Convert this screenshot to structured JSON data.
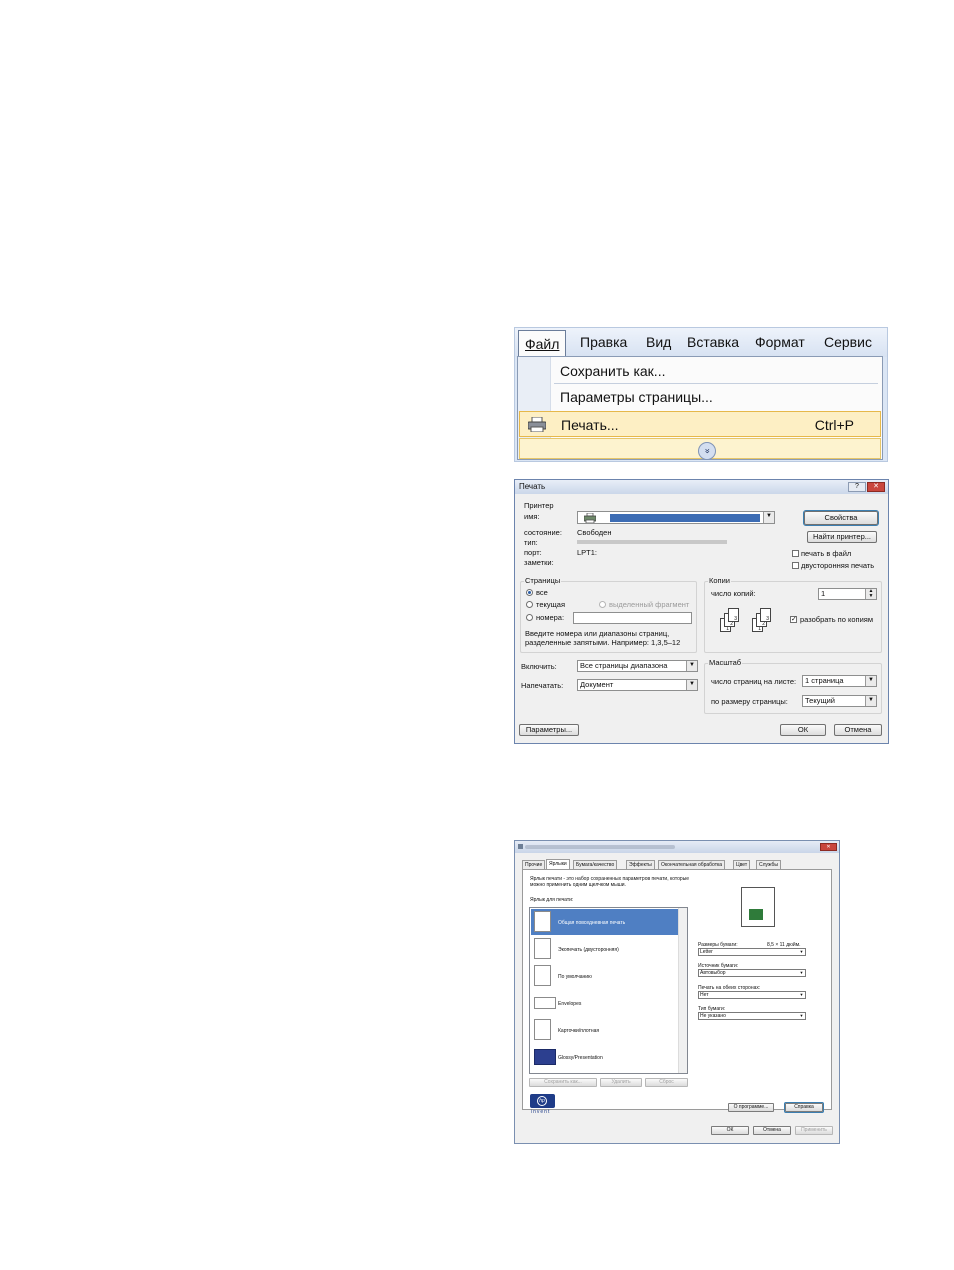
{
  "menu": {
    "bar": {
      "file": "Файл",
      "edit": "Правка",
      "view": "Вид",
      "insert": "Вставка",
      "format": "Формат",
      "tools": "Сервис"
    },
    "items": {
      "save_as": "Сохранить как...",
      "page_setup": "Параметры страницы...",
      "print": "Печать...",
      "print_shortcut": "Ctrl+P",
      "expand_glyph": "»"
    }
  },
  "print_dialog": {
    "title": "Печать",
    "help_glyph": "?",
    "close_glyph": "✕",
    "printer": {
      "group": "Принтер",
      "name_label": "имя:",
      "status_label": "состояние:",
      "status_value": "Свободен",
      "type_label": "тип:",
      "port_label": "порт:",
      "port_value": "LPT1:",
      "notes_label": "заметки:",
      "properties_button": "Свойства",
      "find_printer_button": "Найти принтер...",
      "print_to_file": "печать в файл",
      "duplex": "двусторонняя печать"
    },
    "pages": {
      "group": "Страницы",
      "all": "все",
      "current": "текущая",
      "selection": "выделенный фрагмент",
      "pages": "номера:",
      "hint_1": "Введите номера или диапазоны страниц,",
      "hint_2": "разделенные запятыми. Например: 1,3,5–12"
    },
    "copies": {
      "group": "Копии",
      "count_label": "число копий:",
      "count_value": "1",
      "collate": "разобрать по копиям",
      "sheet_1": "1",
      "sheet_2": "2",
      "sheet_3": "3"
    },
    "include": {
      "label": "Включить:",
      "value": "Все страницы диапазона"
    },
    "print_what": {
      "label": "Напечатать:",
      "value": "Документ"
    },
    "scale": {
      "group": "Масштаб",
      "pages_per_sheet_label": "число страниц на листе:",
      "pages_per_sheet_value": "1 страница",
      "scale_to_label": "по размеру страницы:",
      "scale_to_value": "Текущий"
    },
    "options_button": "Параметры...",
    "ok_button": "ОК",
    "cancel_button": "Отмена"
  },
  "properties_dialog": {
    "close_glyph": "✕",
    "tabs": [
      "Прочие",
      "Ярлыки",
      "Бумага/качество",
      "Эффекты",
      "Окончательная обработка",
      "Цвет",
      "Службы"
    ],
    "active_tab": "Ярлыки",
    "intro_1": "Ярлык печати - это набор сохраненных параметров печати, которые",
    "intro_2": "можно применить одним щелчком мыши.",
    "list_label": "Ярлык для печати:",
    "shortcuts": [
      "Общая повседневная печать",
      "Экопечать (двусторонняя)",
      "По умолчанию",
      "Envelopes",
      "Карточки/плотная",
      "Glossy/Presentation"
    ],
    "paper_size_label": "Размеры бумаги:",
    "paper_size_dims": "8,5 × 11 дюйм.",
    "paper_size_value": "Letter",
    "paper_source_label": "Источник бумаги:",
    "paper_source_value": "Автовыбор",
    "duplex_label": "Печать на обеих сторонах:",
    "duplex_value": "Нет",
    "paper_type_label": "Тип бумаги:",
    "paper_type_value": "Не указано",
    "save_as_button": "Сохранить как...",
    "delete_button": "Удалить",
    "reset_button": "Сброс",
    "about_button": "О программе...",
    "help_button": "Справка",
    "ok_button": "ОК",
    "cancel_button": "Отмена",
    "apply_button": "Применить",
    "brand_sub": "invent"
  }
}
